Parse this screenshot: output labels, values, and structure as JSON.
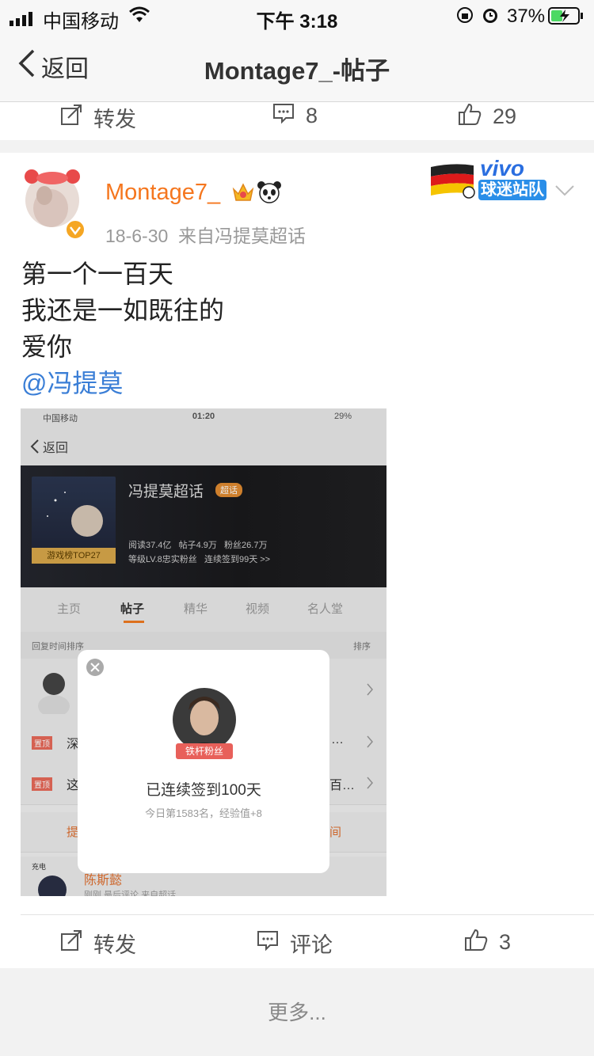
{
  "status_bar": {
    "carrier": "中国移动",
    "time": "下午 3:18",
    "battery": "37%"
  },
  "nav": {
    "back_label": "返回",
    "title": "Montage7_-帖子"
  },
  "prev_actions": {
    "repost_label": "转发",
    "comment_count": "8",
    "like_count": "29"
  },
  "post": {
    "author": "Montage7_",
    "meta": "18-6-30  来自冯提莫超话",
    "badge_brand": "vivo",
    "badge_text": "球迷站队",
    "lines": [
      "第一个一百天",
      "我还是一如既往的",
      "爱你"
    ],
    "mention": "@冯提莫"
  },
  "embedded": {
    "carrier": "中国移动",
    "time": "01:20",
    "battery": "29%",
    "back_label": "返回",
    "topic_name": "冯提莫超话",
    "topic_tag": "超话",
    "cover_badge": "游戏榜TOP27",
    "stats_line1": "阅读37.4亿   帖子4.9万   粉丝26.7万",
    "stats_line2": "等级LV.8忠实粉丝   连续签到99天 >>",
    "tabs": [
      "主页",
      "帖子",
      "精华",
      "视频",
      "名人堂"
    ],
    "sort_left": "回复时间排序",
    "sort_right": "排序",
    "pinned_label": "置顶",
    "row2_left": "深",
    "row2_right": "…",
    "row3_left": "这",
    "row3_right": "百…",
    "row4_left": "提",
    "row4_right": "间",
    "user_bottom": "陈斯懿",
    "user_bottom_sub": "刚刚 最后评论 来自超话",
    "charging_label": "充电",
    "popup": {
      "ribbon": "铁杆粉丝",
      "title": "已连续签到100天",
      "subtitle": "今日第1583名，经验值+8"
    }
  },
  "actions": {
    "repost_label": "转发",
    "comment_label": "评论",
    "like_count": "3"
  },
  "more_label": "更多..."
}
